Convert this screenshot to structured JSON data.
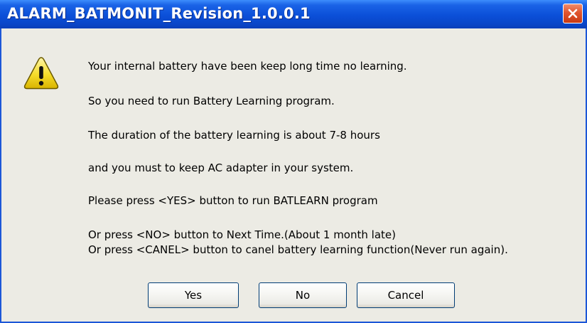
{
  "window": {
    "title": "ALARM_BATMONIT_Revision_1.0.0.1",
    "close_icon": "close-icon",
    "accent_color": "#0b4fd8",
    "close_color": "#e0552f"
  },
  "icon": {
    "name": "warning-icon",
    "glyph": "!",
    "color": "#f5dc2a"
  },
  "message": {
    "line1": "Your internal battery have been keep long time no learning.",
    "line2": "So you need to run Battery Learning program.",
    "line3": "The duration of the battery learning is about 7-8 hours",
    "line4": "and you must to keep AC adapter in your system.",
    "line5": "Please press <YES> button to run BATLEARN program",
    "line6": "Or press <NO> button to Next Time.(About 1 month late)",
    "line7": "Or press <CANEL> button to canel battery learning function(Never run again)."
  },
  "buttons": {
    "yes": "Yes",
    "no": "No",
    "cancel": "Cancel"
  }
}
